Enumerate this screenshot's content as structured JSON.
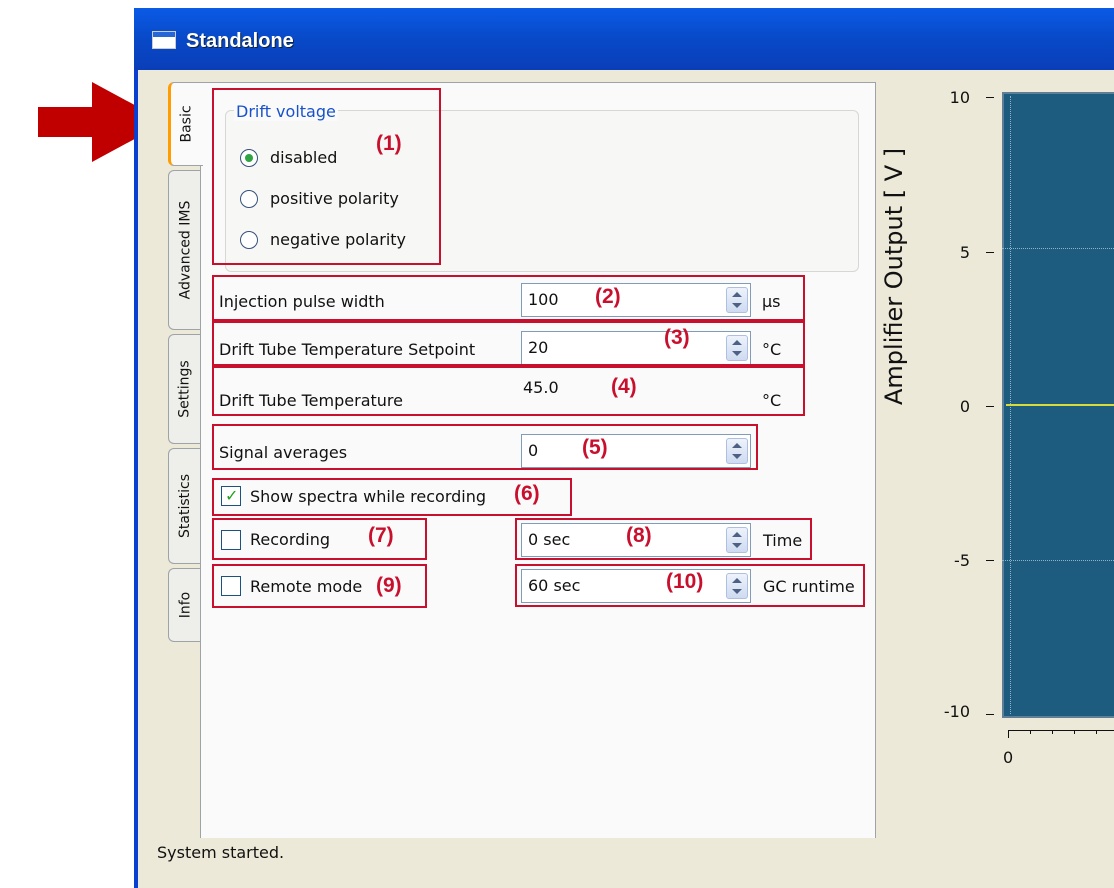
{
  "window": {
    "title": "Standalone"
  },
  "tabs": [
    "Basic",
    "Advanced IMS",
    "Settings",
    "Statistics",
    "Info"
  ],
  "drift_voltage": {
    "title": "Drift voltage",
    "options": [
      "disabled",
      "positive polarity",
      "negative polarity"
    ],
    "selected": "disabled"
  },
  "injection": {
    "label": "Injection pulse width",
    "value": "100",
    "unit": "µs"
  },
  "setpoint": {
    "label": "Drift Tube Temperature Setpoint",
    "value": "20",
    "unit": "°C"
  },
  "temperature": {
    "label": "Drift Tube Temperature",
    "value": "45.0",
    "unit": "°C"
  },
  "averages": {
    "label": "Signal averages",
    "value": "0"
  },
  "show_spectra": {
    "label": "Show spectra while recording",
    "checked": true
  },
  "recording": {
    "label": "Recording",
    "checked": false
  },
  "time": {
    "value": "0 sec",
    "label": "Time"
  },
  "remote": {
    "label": "Remote mode",
    "checked": false
  },
  "gc_runtime": {
    "value": "60 sec",
    "label": "GC runtime"
  },
  "annotations": [
    "(1)",
    "(2)",
    "(3)",
    "(4)",
    "(5)",
    "(6)",
    "(7)",
    "(8)",
    "(9)",
    "(10)"
  ],
  "status": {
    "text": "System started."
  },
  "plot": {
    "ylabel": "Amplifier Output [ V ]",
    "yticks": [
      "10",
      "5",
      "0",
      "-5",
      "-10"
    ],
    "xticks": [
      "0"
    ],
    "background_color": "#1d5c7e",
    "trace_color": "#d8dc3a"
  }
}
